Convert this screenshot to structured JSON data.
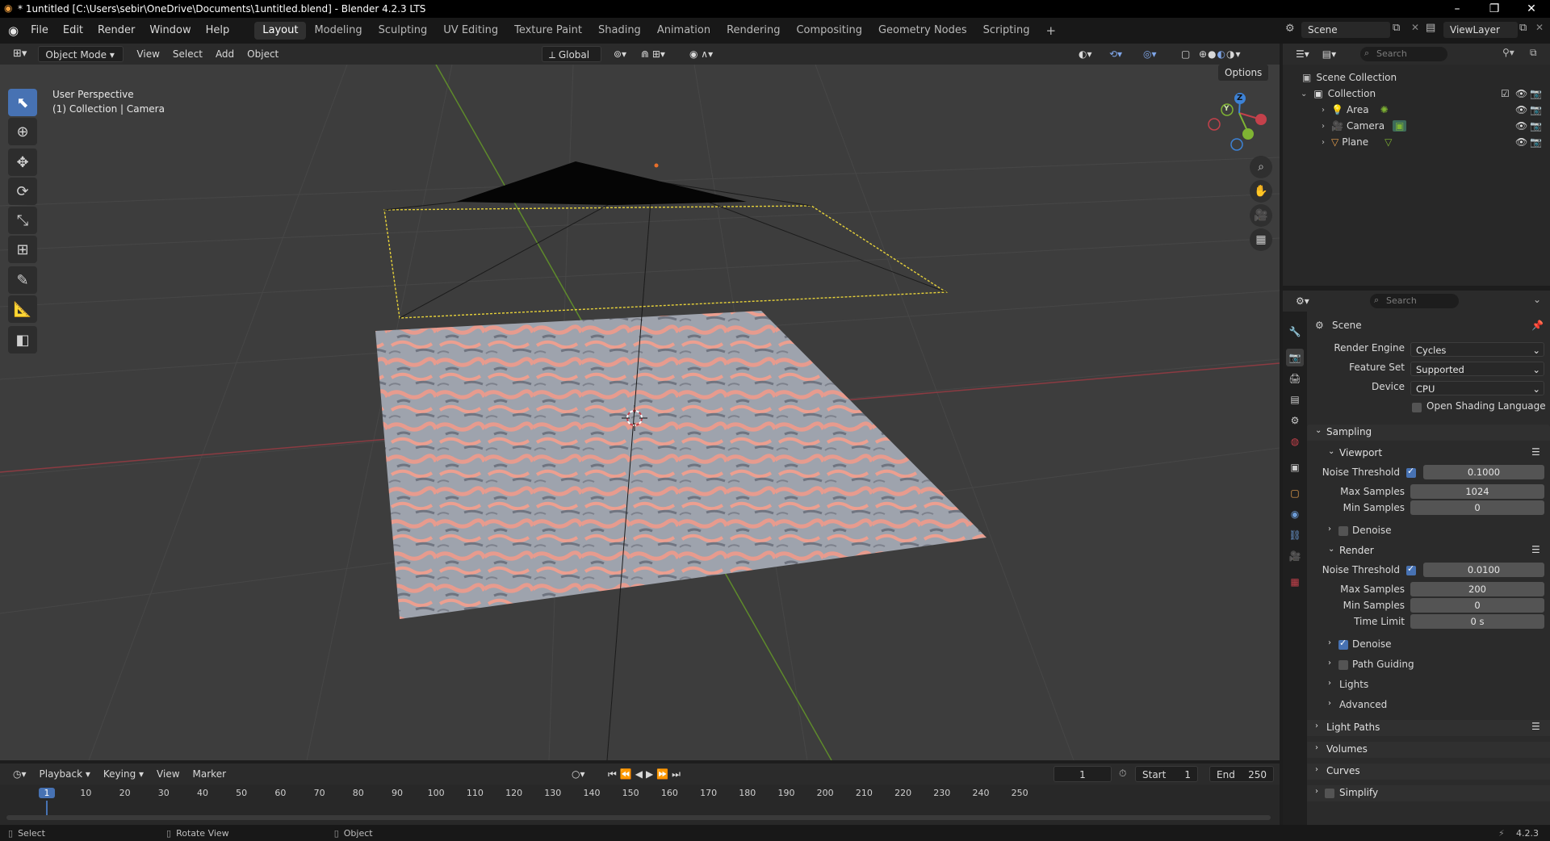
{
  "titlebar": {
    "title": "* 1untitled [C:\\Users\\sebir\\OneDrive\\Documents\\1untitled.blend] - Blender 4.2.3 LTS",
    "minimize": "–",
    "maximize": "❐",
    "close": "✕"
  },
  "menu": [
    "File",
    "Edit",
    "Render",
    "Window",
    "Help"
  ],
  "workspaces": [
    "Layout",
    "Modeling",
    "Sculpting",
    "UV Editing",
    "Texture Paint",
    "Shading",
    "Animation",
    "Rendering",
    "Compositing",
    "Geometry Nodes",
    "Scripting"
  ],
  "active_workspace": "Layout",
  "scene_field": "Scene",
  "viewlayer_field": "ViewLayer",
  "viewport_header": {
    "mode": "Object Mode",
    "menus": [
      "View",
      "Select",
      "Add",
      "Object"
    ],
    "orientation": "Global",
    "options": "Options"
  },
  "viewport": {
    "perspective_label": "User Perspective",
    "collection_label": "(1) Collection | Camera",
    "gizmo": {
      "x": "X",
      "y": "Y",
      "z": "Z"
    }
  },
  "outliner": {
    "search_placeholder": "Search",
    "scene_collection": "Scene Collection",
    "collection": "Collection",
    "items": [
      "Area",
      "Camera",
      "Plane"
    ]
  },
  "properties": {
    "search_placeholder": "Search",
    "context": "Scene",
    "render_engine_label": "Render Engine",
    "render_engine": "Cycles",
    "feature_set_label": "Feature Set",
    "feature_set": "Supported",
    "device_label": "Device",
    "device": "CPU",
    "osl_label": "Open Shading Language",
    "sampling": "Sampling",
    "viewport_section": "Viewport",
    "noise_threshold_label": "Noise Threshold",
    "vp_noise_threshold": "0.1000",
    "max_samples_label": "Max Samples",
    "vp_max_samples": "1024",
    "min_samples_label": "Min Samples",
    "vp_min_samples": "0",
    "denoise_label": "Denoise",
    "render_section": "Render",
    "r_noise_threshold": "0.0100",
    "r_max_samples": "200",
    "r_min_samples": "0",
    "time_limit_label": "Time Limit",
    "r_time_limit": "0 s",
    "path_guiding": "Path Guiding",
    "lights": "Lights",
    "advanced": "Advanced",
    "light_paths": "Light Paths",
    "volumes": "Volumes",
    "curves": "Curves",
    "simplify": "Simplify"
  },
  "timeline": {
    "menus": [
      "Playback",
      "Keying",
      "View",
      "Marker"
    ],
    "current_frame": "1",
    "start_label": "Start",
    "start": "1",
    "end_label": "End",
    "end": "250",
    "ticks": [
      "1",
      "10",
      "20",
      "30",
      "40",
      "50",
      "60",
      "70",
      "80",
      "90",
      "100",
      "110",
      "120",
      "130",
      "140",
      "150",
      "160",
      "170",
      "180",
      "190",
      "200",
      "210",
      "220",
      "230",
      "240",
      "250"
    ]
  },
  "statusbar": {
    "select": "Select",
    "rotate": "Rotate View",
    "object": "Object",
    "version": "4.2.3"
  },
  "colors": {
    "accent": "#4772b3",
    "x_axis": "#c4414b",
    "y_axis": "#7fb433",
    "z_axis": "#3d82d6",
    "selection": "#e6d13a"
  }
}
